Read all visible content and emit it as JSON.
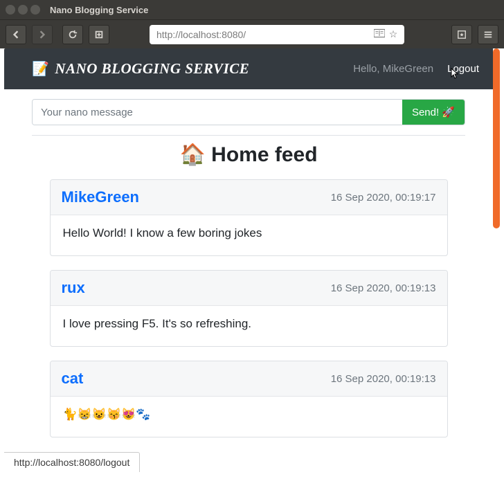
{
  "window": {
    "title": "Nano Blogging Service"
  },
  "browser": {
    "url": "http://localhost:8080/",
    "status_link": "http://localhost:8080/logout"
  },
  "nav": {
    "brand_emoji": "📝",
    "brand_text": "NANO BLOGGING SERVICE",
    "greeting": "Hello, MikeGreen",
    "logout": "Logout"
  },
  "compose": {
    "placeholder": "Your nano message",
    "send_label": "Send! 🚀"
  },
  "feed_title": "🏠 Home feed",
  "posts": [
    {
      "author": "MikeGreen",
      "timestamp": "16 Sep 2020, 00:19:17",
      "body": "Hello World! I know a few boring jokes"
    },
    {
      "author": "rux",
      "timestamp": "16 Sep 2020, 00:19:13",
      "body": "I love pressing F5. It's so refreshing."
    },
    {
      "author": "cat",
      "timestamp": "16 Sep 2020, 00:19:13",
      "body": "🐈😸😺😽😻🐾"
    }
  ]
}
